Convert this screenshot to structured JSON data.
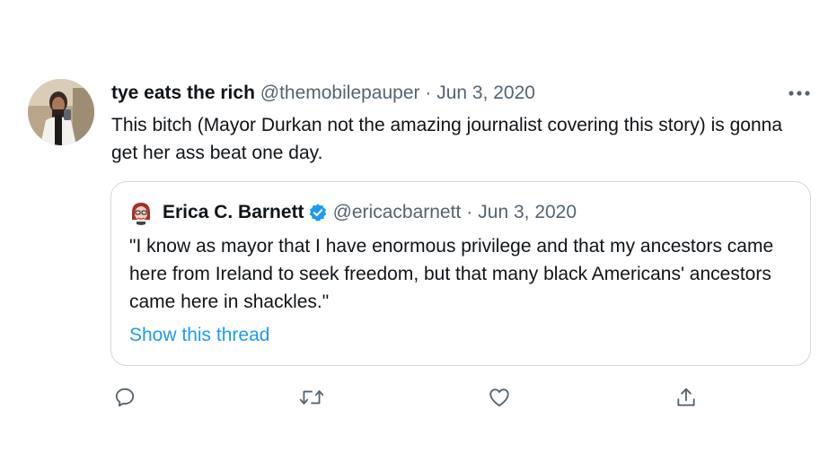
{
  "tweet": {
    "display_name": "tye eats the rich",
    "handle": "@themobilepauper",
    "separator": "·",
    "date": "Jun 3, 2020",
    "text": "This bitch (Mayor Durkan not the amazing journalist covering this story) is gonna get her ass beat one day.",
    "more_icon": "more-horizontal-icon"
  },
  "quote": {
    "display_name": "Erica C. Barnett",
    "verified_icon": "verified-badge-icon",
    "handle": "@ericacbarnett",
    "separator": "·",
    "date": "Jun 3, 2020",
    "text": "\"I know as mayor that I have enormous privilege and that my ancestors came here from Ireland to seek freedom, but that many black Americans' ancestors came here in shackles.\"",
    "show_thread": "Show this thread"
  },
  "actions": [
    {
      "icon": "reply-icon"
    },
    {
      "icon": "retweet-icon"
    },
    {
      "icon": "like-icon"
    },
    {
      "icon": "share-icon"
    }
  ],
  "colors": {
    "text": "#0f1419",
    "muted": "#536471",
    "link": "#1d9bf0",
    "border": "#cfd9de"
  }
}
